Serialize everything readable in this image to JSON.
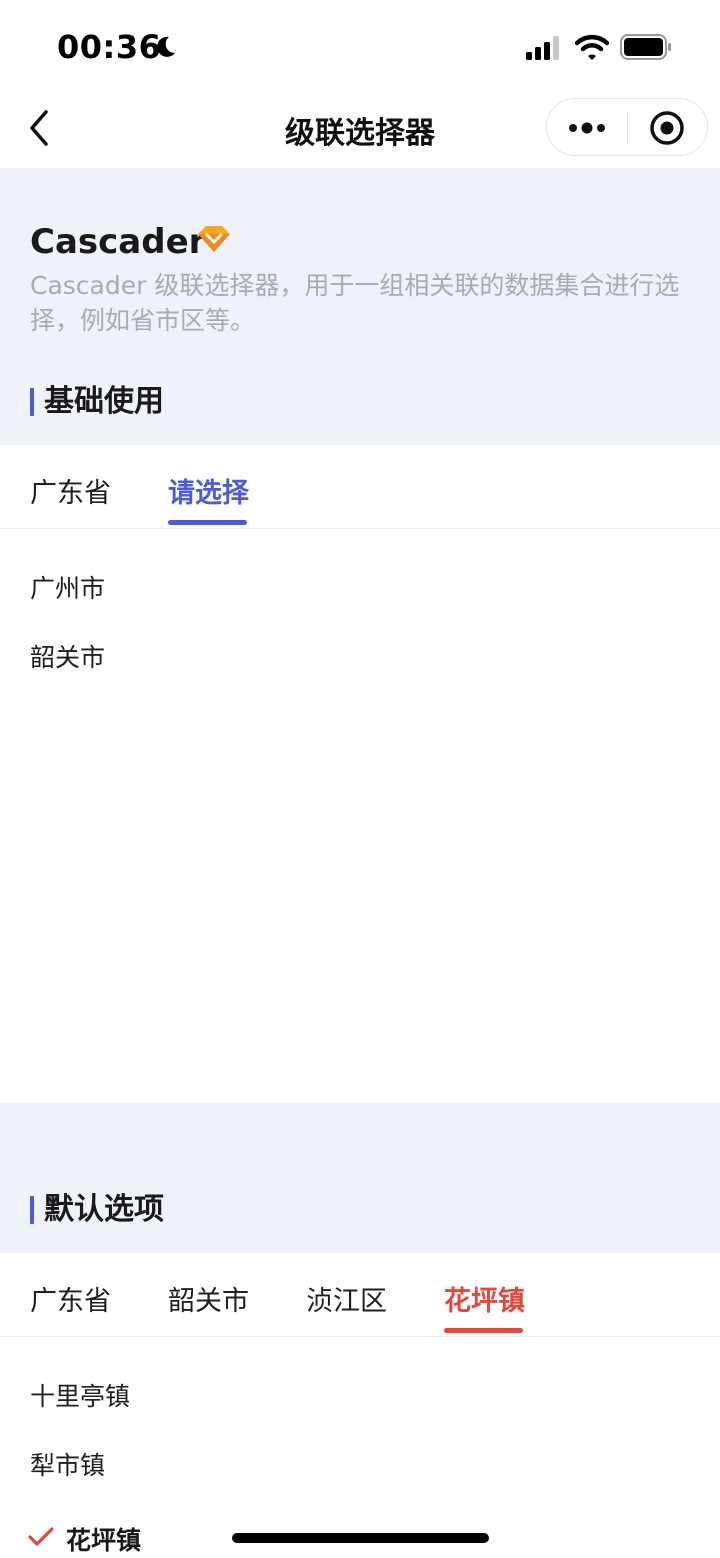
{
  "status_bar": {
    "time": "00:36"
  },
  "nav": {
    "title": "级联选择器"
  },
  "intro": {
    "title": "Cascader",
    "description": "Cascader 级联选择器，用于一组相关联的数据集合进行选择，例如省市区等。"
  },
  "sections": [
    {
      "title": "基础使用",
      "tabs": [
        "广东省",
        "请选择"
      ],
      "active_tab": 1,
      "options": [
        "广州市",
        "韶关市"
      ]
    },
    {
      "title": "默认选项",
      "tabs": [
        "广东省",
        "韶关市",
        "浈江区",
        "花坪镇"
      ],
      "active_tab": 3,
      "options": [
        "十里亭镇",
        "犁市镇",
        "花坪镇"
      ],
      "selected_option": 2
    }
  ],
  "colors": {
    "accent_blue": "#4e5bd6",
    "accent_red": "#e04a3c",
    "page_bg": "#eff2f8"
  },
  "icons": [
    "moon-icon",
    "signal-icon",
    "wifi-icon",
    "battery-icon",
    "back-chevron-icon",
    "more-dots-icon",
    "target-close-icon",
    "diamond-icon",
    "check-icon"
  ]
}
